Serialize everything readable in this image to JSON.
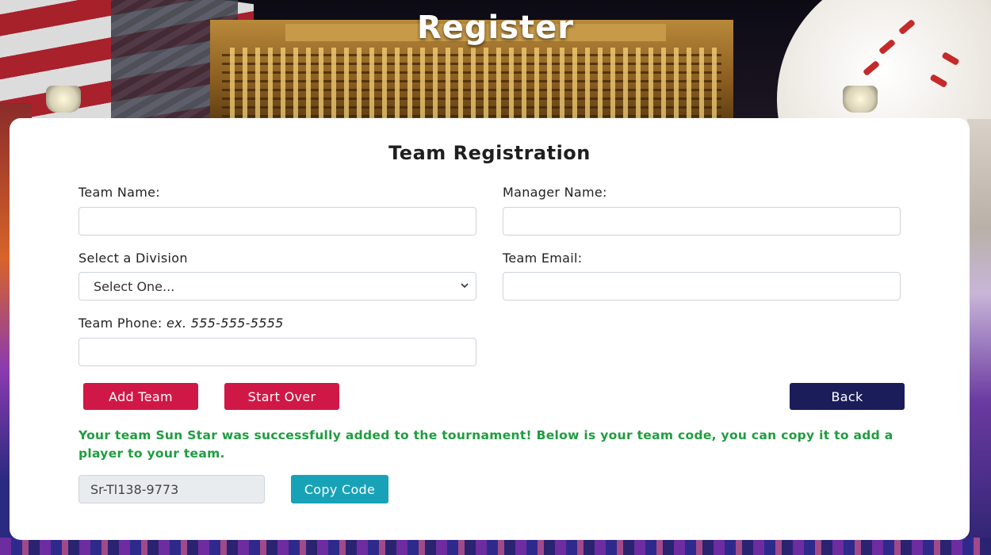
{
  "header": {
    "title": "Register"
  },
  "form": {
    "title": "Team Registration",
    "team_name": {
      "label": "Team Name:",
      "value": "",
      "placeholder": ""
    },
    "manager_name": {
      "label": "Manager Name:",
      "value": "",
      "placeholder": ""
    },
    "division": {
      "label": "Select a Division",
      "selected": "Select One..."
    },
    "team_email": {
      "label": "Team Email:",
      "value": "",
      "placeholder": ""
    },
    "team_phone": {
      "label": "Team Phone:",
      "hint": "ex. 555-555-5555",
      "value": "",
      "placeholder": ""
    },
    "buttons": {
      "add_team": "Add Team",
      "start_over": "Start Over",
      "back": "Back"
    }
  },
  "result": {
    "message": "Your team Sun Star was successfully added to the tournament! Below is your team code, you can copy it to add a player to your team.",
    "team_code": "Sr-Tl138-9773",
    "copy_label": "Copy Code"
  },
  "colors": {
    "primary_red": "#d01846",
    "navy": "#1b1d5a",
    "teal": "#18a2b8",
    "success_green": "#1e9d3f"
  },
  "icons": {
    "select_arrow": "chevron-down-icon"
  }
}
